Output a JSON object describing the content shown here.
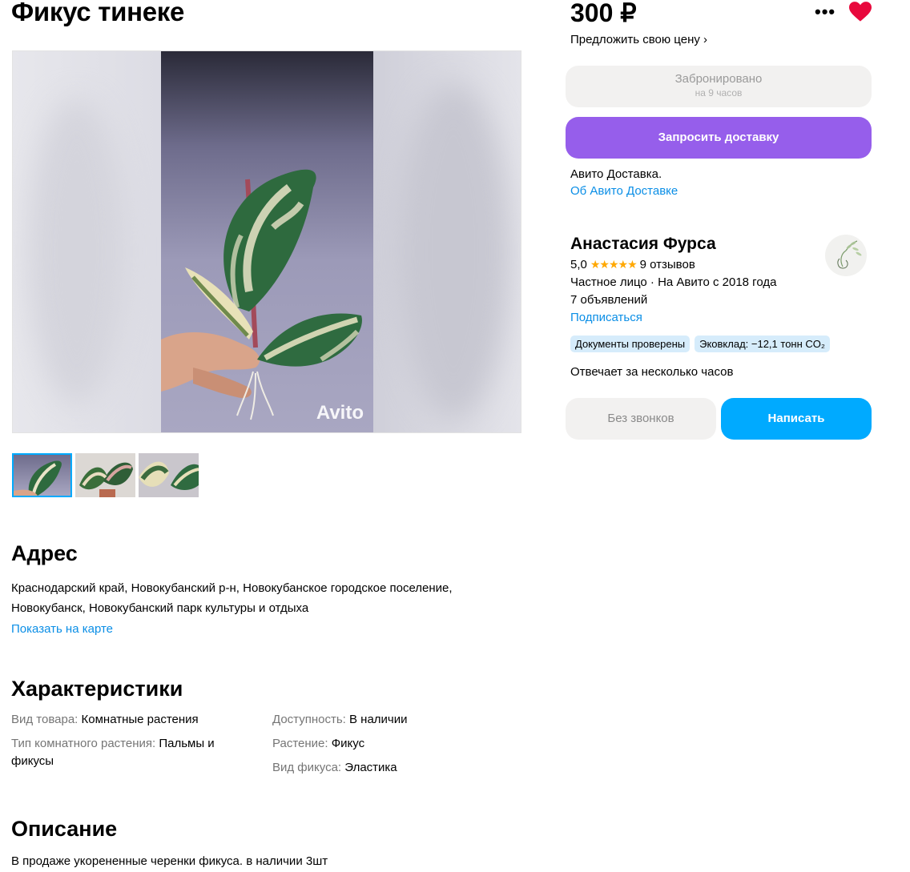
{
  "listing": {
    "title": "Фикус тинеке",
    "watermark": "Avito"
  },
  "address": {
    "heading": "Адрес",
    "line1": "Краснодарский край, Новокубанский р-н, Новокубанское городское поселение,",
    "line2": "Новокубанск, Новокубанский парк культуры и отдыха",
    "map_link": "Показать на карте"
  },
  "characteristics": {
    "heading": "Характеристики",
    "left": [
      {
        "key": "Вид товара:",
        "value": "Комнатные растения"
      },
      {
        "key": "Тип комнатного растения:",
        "value": "Пальмы и"
      },
      {
        "key": "",
        "value": "фикусы"
      }
    ],
    "right": [
      {
        "key": "Доступность:",
        "value": "В наличии"
      },
      {
        "key": "Растение:",
        "value": "Фикус"
      },
      {
        "key": "Вид фикуса:",
        "value": "Эластика"
      }
    ]
  },
  "description": {
    "heading": "Описание",
    "text": "В продаже укорененные черенки фикуса. в наличии 3шт"
  },
  "sidebar": {
    "price": "300 ₽",
    "offer_price": "Предложить свою цену ›",
    "more": "•••",
    "reserved_label": "Забронировано",
    "reserved_sub": "на 9 часов",
    "delivery_button": "Запросить доставку",
    "delivery_text": "Авито Доставка.",
    "delivery_link": "Об Авито Доставке"
  },
  "seller": {
    "name": "Анастасия Фурса",
    "rating": "5,0",
    "stars": "★★★★★",
    "reviews": "9 отзывов",
    "type_line": "Частное лицо · На Авито с 2018 года",
    "listings": "7 объявлений",
    "subscribe": "Подписаться",
    "badges": [
      "Документы проверены",
      "Эковклад: −12,1 тонн CO₂"
    ],
    "response": "Отвечает за несколько часов",
    "no_calls": "Без звонков",
    "write": "Написать"
  },
  "colors": {
    "accent_purple": "#965eeb",
    "accent_blue": "#00aaff",
    "link": "#0a8ee6",
    "heart": "#e8093d"
  }
}
